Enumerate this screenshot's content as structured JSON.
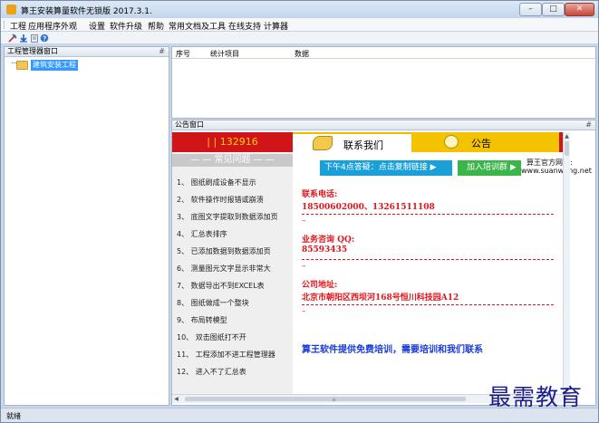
{
  "window": {
    "title": "算王安装算量软件无锁版 2017.3.1.",
    "min_glyph": "–",
    "max_glyph": "□",
    "close_glyph": "✕"
  },
  "menu": {
    "items": [
      "工程",
      "应用程序外观",
      "设置",
      "软件升级",
      "帮助",
      "常用文档及工具",
      "在线支持",
      "计算器"
    ]
  },
  "toolbar": {
    "icons": [
      "tools-icon",
      "download-icon",
      "clipboard-icon",
      "help-icon"
    ]
  },
  "left_panel": {
    "title": "工程管理器窗口",
    "pin_glyph": "#",
    "tree_items": [
      {
        "label": "建筑安装工程"
      }
    ]
  },
  "top_panel": {
    "columns": [
      "序号",
      "统计项目",
      "数据"
    ]
  },
  "bulletin": {
    "title": "公告窗口",
    "pin_glyph": "#",
    "banner": {
      "counter": "| | 132916",
      "contact_title": "联系我们",
      "notice_title": "公告"
    },
    "faq": {
      "heading": "— — 常见问题 — —",
      "items": [
        "1、 图纸刷成设备不显示",
        "2、 软件操作时报错或崩溃",
        "3、 底图文字提取到数据添加页",
        "4、 汇总表排序",
        "5、 已添加数据到数据添加页",
        "6、 测量图元文字显示非常大",
        "7、 数据导出不到EXCEL表",
        "8、 图纸做成一个整块",
        "9、 布局转模型",
        "10、 双击图纸打不开",
        "11、 工程添加不进工程管理器",
        "12、 进入不了汇总表"
      ]
    },
    "contact": {
      "link_button": "下午4点答疑：点击复制链接 ▶",
      "train_button": "加入培训群 ▶",
      "site_label": "算王官方网站:",
      "site_url": "www.suanwang.net",
      "phone_label": "联系电话:",
      "phone_value": "18500602000、13261511108",
      "qq_label": "业务咨询 QQ:",
      "qq_value": "85593435",
      "address_label": "公司地址:",
      "address_value": "北京市朝阳区西坝河168号恒川科技园A12",
      "dash_mark": "–",
      "footer": "算王软件提供免费培训，需要培训和我们联系"
    }
  },
  "scroll": {
    "up_glyph": "▲",
    "down_glyph": "▼",
    "left_glyph": "◀",
    "right_glyph": "▶",
    "grip_glyph": "≡"
  },
  "status": {
    "text": "就绪"
  },
  "watermark": "最需教育",
  "colors": {
    "banner_red": "#d0141a",
    "notice_yellow": "#f4c300",
    "contact_red": "#e0161d",
    "footer_blue": "#1a39d8",
    "link_blue": "#1aa0d8",
    "train_green": "#3ab54a"
  }
}
